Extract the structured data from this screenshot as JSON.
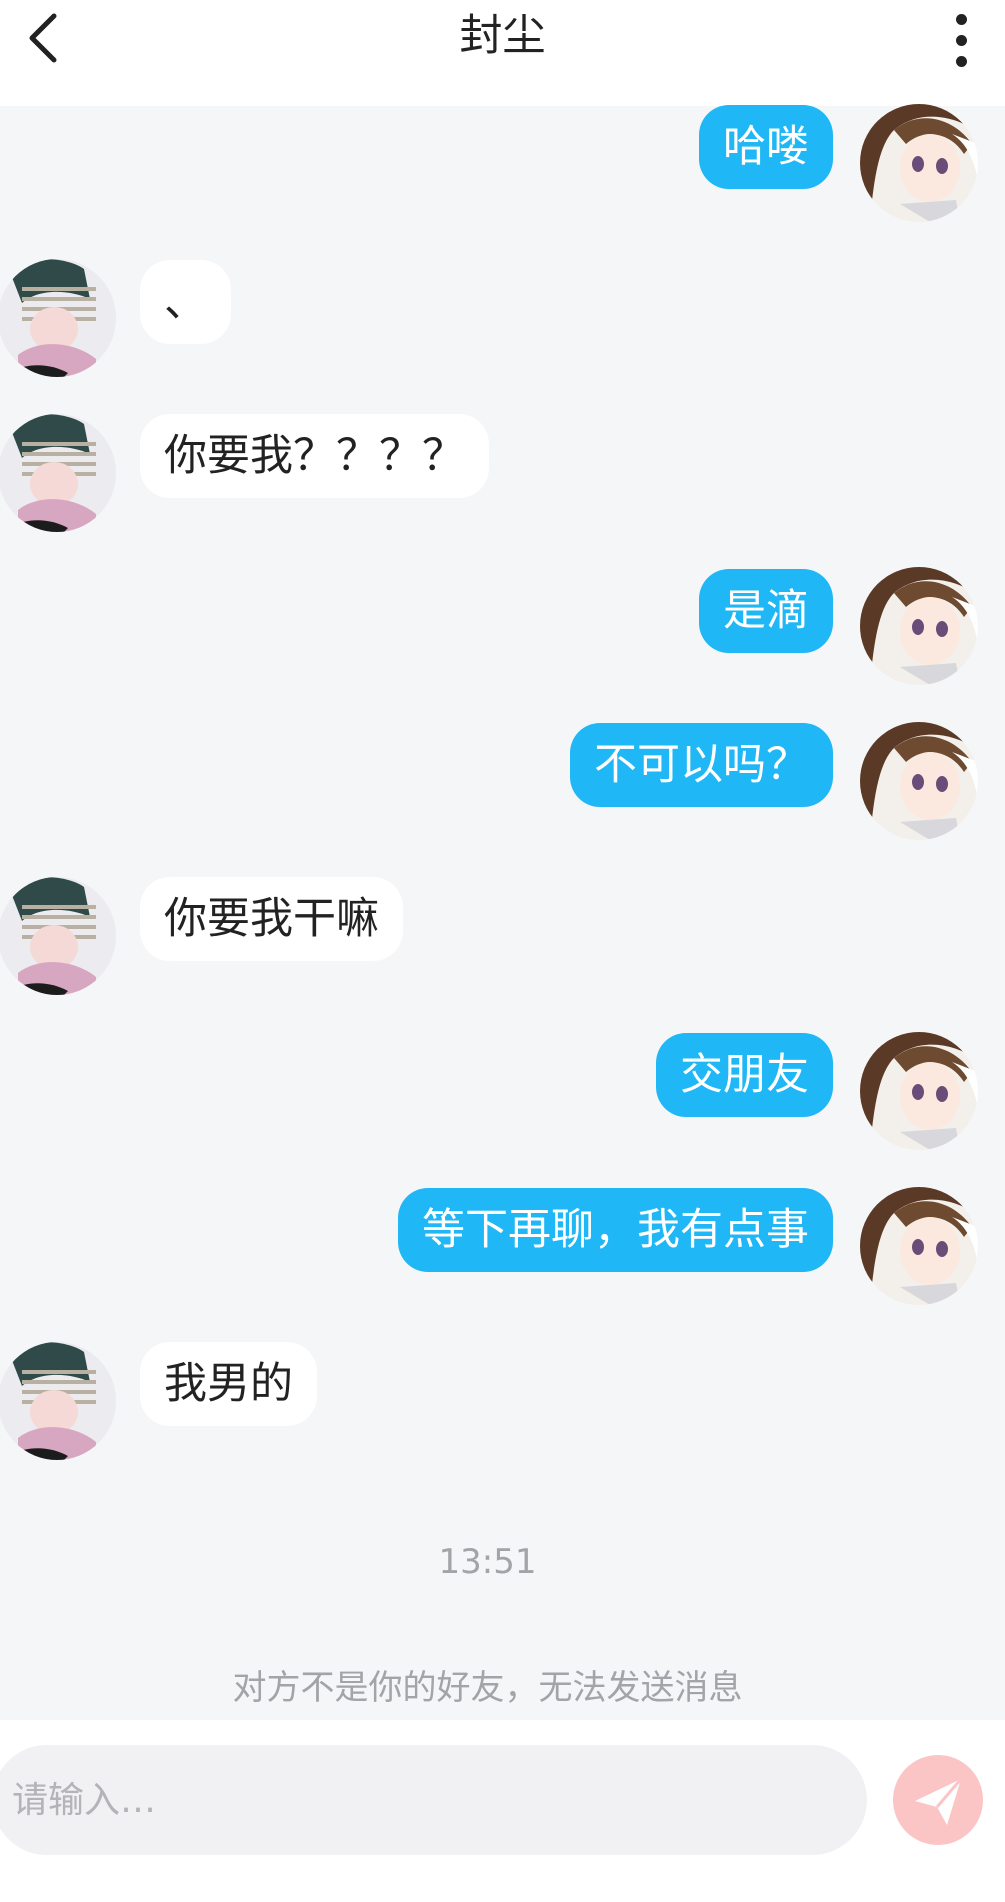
{
  "header": {
    "title": "封尘"
  },
  "messages": [
    {
      "text": "哈喽"
    },
    {
      "text": "、"
    },
    {
      "text": "你要我？？？？"
    },
    {
      "text": "是滴"
    },
    {
      "text": "不可以吗？"
    },
    {
      "text": "你要我干嘛"
    },
    {
      "text": "交朋友"
    },
    {
      "text": "等下再聊，我有点事"
    },
    {
      "text": "我男的"
    }
  ],
  "timestamp": "13:51",
  "notice": "对方不是你的好友，无法发送消息",
  "composer": {
    "placeholder": "请输入…"
  },
  "colors": {
    "mine_bubble": "#1fb7f5",
    "theirs_bubble": "#ffffff",
    "background": "#f5f6f8",
    "send_button": "#fbc5c5"
  }
}
